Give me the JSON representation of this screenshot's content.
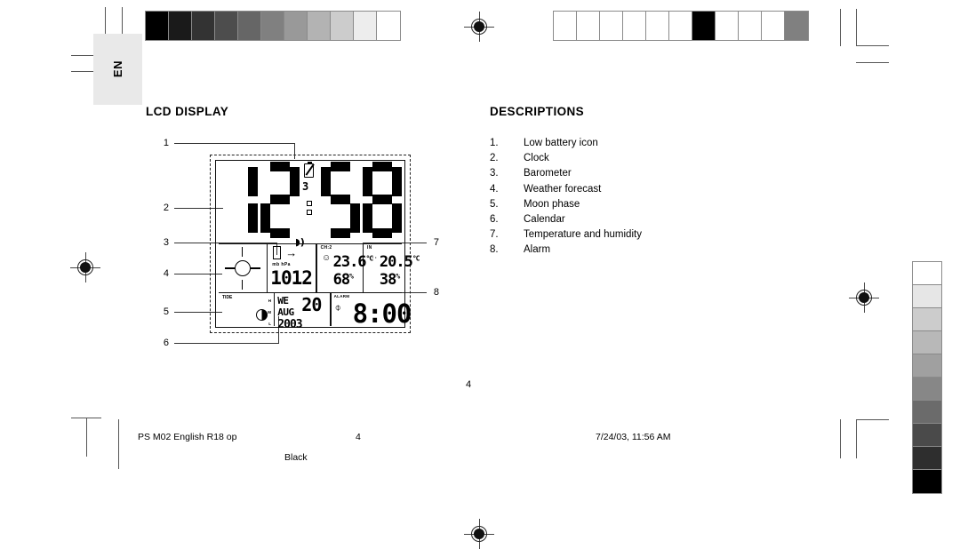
{
  "page": {
    "language_tab": "EN",
    "center_page_number": "4"
  },
  "sections": {
    "lcd_heading": "LCD DISPLAY",
    "descriptions_heading": "DESCRIPTIONS"
  },
  "descriptions": [
    {
      "num": "1.",
      "label": "Low battery icon"
    },
    {
      "num": "2.",
      "label": "Clock"
    },
    {
      "num": "3.",
      "label": "Barometer"
    },
    {
      "num": "4.",
      "label": "Weather forecast"
    },
    {
      "num": "5.",
      "label": "Moon phase"
    },
    {
      "num": "6.",
      "label": "Calendar"
    },
    {
      "num": "7.",
      "label": "Temperature and humidity"
    },
    {
      "num": "8.",
      "label": "Alarm"
    }
  ],
  "callouts": {
    "left": [
      "1",
      "2",
      "3",
      "4",
      "5",
      "6"
    ],
    "right": [
      "7",
      "8"
    ]
  },
  "lcd": {
    "clock": {
      "digits": [
        "1",
        "2",
        "5",
        "8"
      ],
      "battery_icon": "low-battery",
      "rf_indicator": "3",
      "colon": ":",
      "wave_icon": "signal-wave"
    },
    "barometer": {
      "value": "1012",
      "units": "mb hPa",
      "trend_arrow": "→",
      "box_icon": "pressure-box"
    },
    "weather_forecast": {
      "icon": "sunny"
    },
    "moon": {
      "tide_label": "TIDE",
      "phase": "half-moon",
      "levels": [
        "H",
        "M",
        "L"
      ]
    },
    "calendar": {
      "weekday": "WE",
      "month": "AUG",
      "day": "20",
      "year": "2003"
    },
    "channel_outdoor": {
      "label": "CH:2",
      "temperature": "23.6",
      "temp_unit": "°C",
      "humidity": "68",
      "humidity_unit": "%",
      "comfort_face": "smiley"
    },
    "indoor": {
      "label": "IN",
      "temperature": "20.5",
      "temp_unit": "°C",
      "humidity": "38",
      "humidity_unit": "%"
    },
    "alarm": {
      "label": "ALARM",
      "time": "8:00",
      "icon": "alarm-off-bell"
    }
  },
  "footer": {
    "job_name": "PS M02 English R18 op",
    "page_number": "4",
    "timestamp": "7/24/03, 11:56 AM",
    "plate": "Black"
  },
  "calibration": {
    "top_left_strip": [
      "#000000",
      "#1a1a1a",
      "#333333",
      "#4d4d4d",
      "#666666",
      "#808080",
      "#999999",
      "#b3b3b3",
      "#cccccc",
      "#ededed",
      "#ffffff"
    ],
    "top_right_strip": [
      "#ffffff",
      "#ffffff",
      "#ffffff",
      "#ffffff",
      "#ffffff",
      "#ffffff",
      "#000000",
      "#ffffff",
      "#ffffff",
      "#ffffff",
      "#808080"
    ],
    "right_vertical_strip": [
      "#ffffff",
      "#e6e6e6",
      "#cccccc",
      "#b8b8b8",
      "#a0a0a0",
      "#878787",
      "#6b6b6b",
      "#4a4a4a",
      "#2e2e2e",
      "#000000"
    ]
  }
}
